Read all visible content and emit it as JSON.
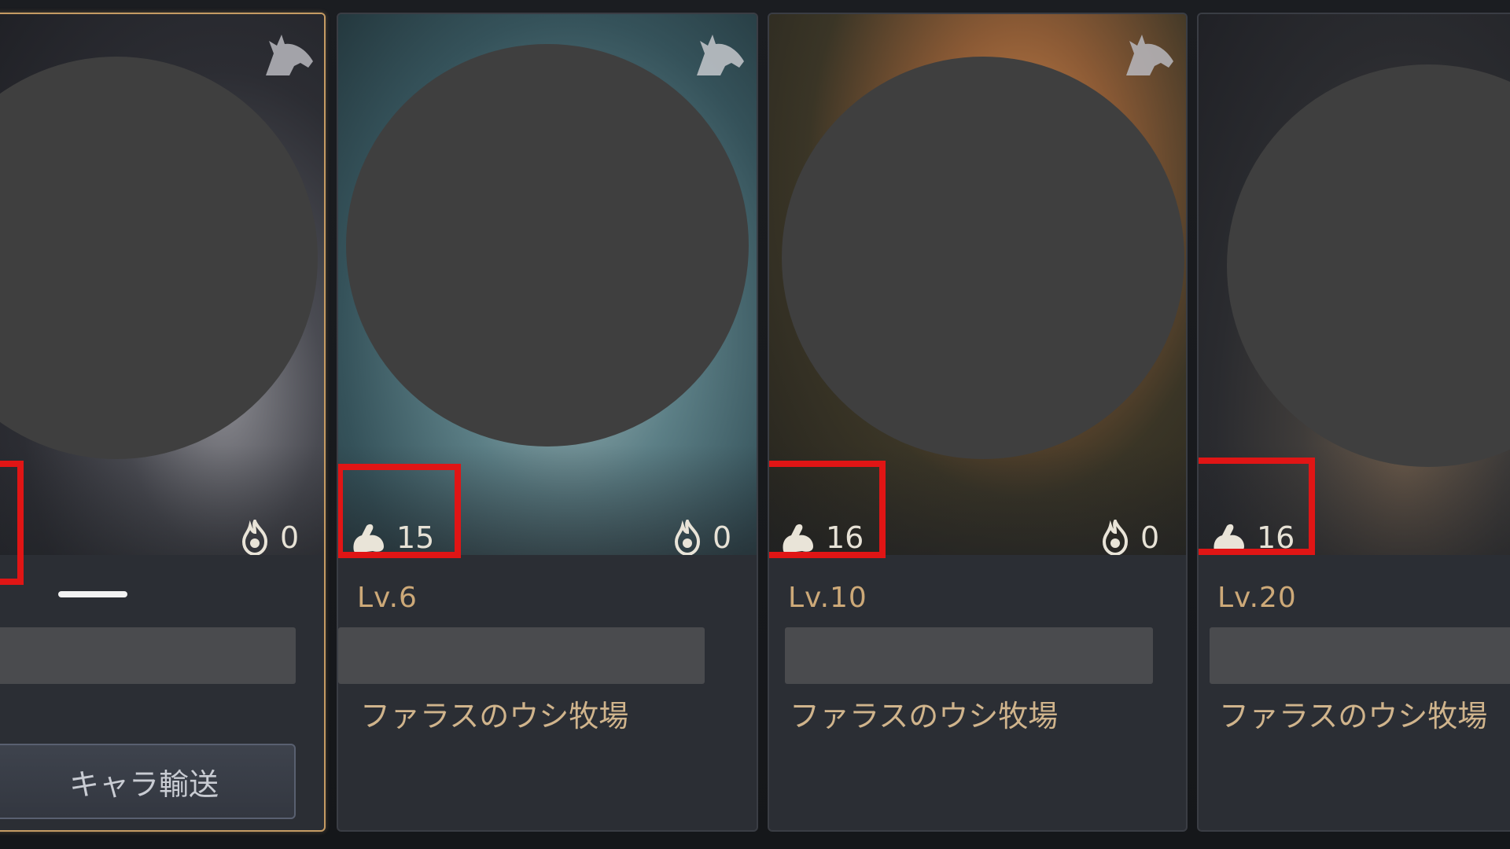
{
  "cards": [
    {
      "selected": true,
      "level": "",
      "location": "",
      "flame_value": "0",
      "stat_value": "",
      "transfer_button_label": "キャラ輸送"
    },
    {
      "selected": false,
      "level": "Lv.6",
      "location": "ファラスのウシ牧場",
      "flame_value": "0",
      "stat_value": "15"
    },
    {
      "selected": false,
      "level": "Lv.10",
      "location": "ファラスのウシ牧場",
      "flame_value": "0",
      "stat_value": "16"
    },
    {
      "selected": false,
      "level": "Lv.20",
      "location": "ファラスのウシ牧場",
      "stat_value": "16"
    }
  ],
  "colors": {
    "highlight": "#e01515",
    "selected_border": "#c59b63",
    "level_text": "#cda978",
    "location_text": "#d0b48c"
  },
  "icons": {
    "mount": "horse-head-icon",
    "flame": "flame-icon",
    "stat": "arm-strength-icon"
  }
}
